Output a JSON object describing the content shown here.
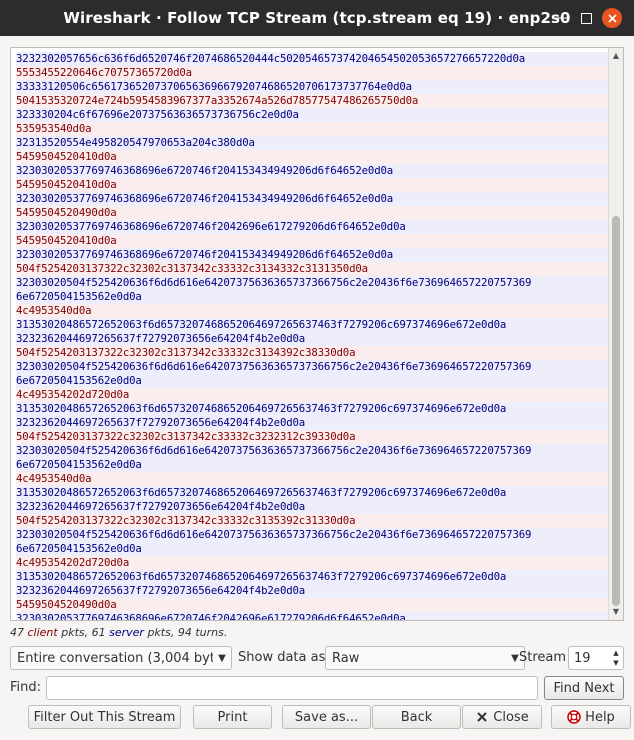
{
  "window": {
    "title": "Wireshark · Follow TCP Stream (tcp.stream eq 19) · enp2s0"
  },
  "colors": {
    "client_text": "#7f0000",
    "server_text": "#00007f",
    "titlebar_bg": "#2c2c2c",
    "close_button": "#e95420"
  },
  "stream": {
    "lines": [
      {
        "dir": "server",
        "text": "3232302057656c636f6d6520746f2074686520444c502054657374204654502053657276657220d0a"
      },
      {
        "dir": "client",
        "text": "5553455220646c70757365720d0a"
      },
      {
        "dir": "server",
        "text": "33333120506c6561736520737065636966792074686520706173737764e0d0a"
      },
      {
        "dir": "client",
        "text": "5041535320724e724b5954583967377a3352674a526d78577547486265750d0a"
      },
      {
        "dir": "server",
        "text": "323330204c6f67696e20737563636573736756c2e0d0a"
      },
      {
        "dir": "client",
        "text": "535953540d0a"
      },
      {
        "dir": "server",
        "text": "32313520554e495820547970653a204c380d0a"
      },
      {
        "dir": "client",
        "text": "5459504520410d0a"
      },
      {
        "dir": "server",
        "text": "32303020537769746368696e6720746f204153434949206d6f64652e0d0a"
      },
      {
        "dir": "client",
        "text": "5459504520410d0a"
      },
      {
        "dir": "server",
        "text": "32303020537769746368696e6720746f204153434949206d6f64652e0d0a"
      },
      {
        "dir": "client",
        "text": "5459504520490d0a"
      },
      {
        "dir": "server",
        "text": "32303020537769746368696e6720746f2042696e617279206d6f64652e0d0a"
      },
      {
        "dir": "client",
        "text": "5459504520410d0a"
      },
      {
        "dir": "server",
        "text": "32303020537769746368696e6720746f204153434949206d6f64652e0d0a"
      },
      {
        "dir": "client",
        "text": "504f5254203137322c32302c3137342c33332c3134332c3131350d0a"
      },
      {
        "dir": "server",
        "text": "32303020504f525420636f6d6d616e64207375636365737366756c2e20436f6e736964657220757369"
      },
      {
        "dir": "server",
        "text": "6e6720504153562e0d0a"
      },
      {
        "dir": "client",
        "text": "4c4953540d0a"
      },
      {
        "dir": "server",
        "text": "31353020486572652063f6d6573207468652064697265637463f7279206c697374696e672e0d0a"
      },
      {
        "dir": "server",
        "text": "3232362044697265637f72792073656e64204f4b2e0d0a"
      },
      {
        "dir": "client",
        "text": "504f5254203137322c32302c3137342c33332c3134392c38330d0a"
      },
      {
        "dir": "server",
        "text": "32303020504f525420636f6d6d616e64207375636365737366756c2e20436f6e736964657220757369"
      },
      {
        "dir": "server",
        "text": "6e6720504153562e0d0a"
      },
      {
        "dir": "client",
        "text": "4c495354202d720d0a"
      },
      {
        "dir": "server",
        "text": "31353020486572652063f6d6573207468652064697265637463f7279206c697374696e672e0d0a"
      },
      {
        "dir": "server",
        "text": "3232362044697265637f72792073656e64204f4b2e0d0a"
      },
      {
        "dir": "client",
        "text": "504f5254203137322c32302c3137342c33332c3232312c39330d0a"
      },
      {
        "dir": "server",
        "text": "32303020504f525420636f6d6d616e64207375636365737366756c2e20436f6e736964657220757369"
      },
      {
        "dir": "server",
        "text": "6e6720504153562e0d0a"
      },
      {
        "dir": "client",
        "text": "4c4953540d0a"
      },
      {
        "dir": "server",
        "text": "31353020486572652063f6d6573207468652064697265637463f7279206c697374696e672e0d0a"
      },
      {
        "dir": "server",
        "text": "3232362044697265637f72792073656e64204f4b2e0d0a"
      },
      {
        "dir": "client",
        "text": "504f5254203137322c32302c3137342c33332c3135392c31330d0a"
      },
      {
        "dir": "server",
        "text": "32303020504f525420636f6d6d616e64207375636365737366756c2e20436f6e736964657220757369"
      },
      {
        "dir": "server",
        "text": "6e6720504153562e0d0a"
      },
      {
        "dir": "client",
        "text": "4c495354202d720d0a"
      },
      {
        "dir": "server",
        "text": "31353020486572652063f6d6573207468652064697265637463f7279206c697374696e672e0d0a"
      },
      {
        "dir": "server",
        "text": "3232362044697265637f72792073656e64204f4b2e0d0a"
      },
      {
        "dir": "client",
        "text": "5459504520490d0a"
      },
      {
        "dir": "server",
        "text": "32303020537769746368696e6720746f2042696e617279206d6f64652e0d0a"
      }
    ]
  },
  "summary": {
    "client_count": "47",
    "client_word": "client",
    "middle": "pkts,",
    "server_count": "61",
    "server_word": "server",
    "end": "pkts, 94 turns."
  },
  "controls": {
    "conversation_select": "Entire conversation (3,004 bytes)",
    "show_data_label": "Show data as",
    "show_data_select": "Raw",
    "stream_label": "Stream",
    "stream_value": "19",
    "find_label": "Find:",
    "find_value": "",
    "find_next_label": "Find Next"
  },
  "buttons": {
    "filter_out": "Filter Out This Stream",
    "print": "Print",
    "save_as": "Save as...",
    "back": "Back",
    "close": "Close",
    "help": "Help"
  },
  "icons": {
    "close_icon": "close-icon",
    "help_icon": "help-icon",
    "dropdown_icon": "chevron-down-icon"
  }
}
